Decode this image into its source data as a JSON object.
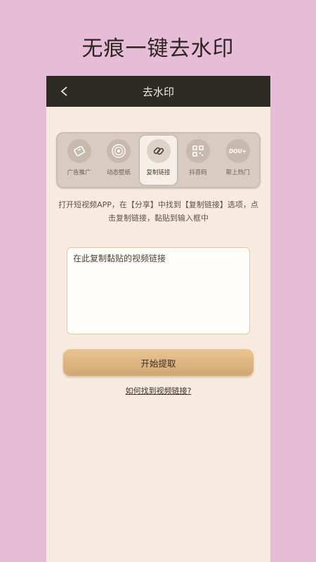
{
  "banner": {
    "title": "无痕一键去水印"
  },
  "navbar": {
    "title": "去水印",
    "back_icon": "chevron-left-icon"
  },
  "toolbar": {
    "items": [
      {
        "label": "广告推广",
        "icon": "megaphone-icon",
        "active": false
      },
      {
        "label": "动态壁纸",
        "icon": "disc-icon",
        "active": false
      },
      {
        "label": "复制链接",
        "icon": "link-icon",
        "active": true
      },
      {
        "label": "抖音码",
        "icon": "qr-code-icon",
        "active": false
      },
      {
        "label": "帮上热门",
        "icon": "dou-plus-icon",
        "active": false
      }
    ],
    "dou_text": "DOU+"
  },
  "hint": {
    "text": "打开短视频APP，在【分享】中找到【复制链接】选项，点击复制链接，黏贴到输入框中"
  },
  "input": {
    "placeholder": "在此复制黏贴的视频链接",
    "value": ""
  },
  "start_button": {
    "label": "开始提取"
  },
  "help_link": {
    "label": "如何找到视频链接?"
  },
  "colors": {
    "accent": "#d9b07e",
    "navbar": "#2e2a26",
    "page_bg": "#e6bcd6",
    "content_bg": "#f7ebdf"
  }
}
